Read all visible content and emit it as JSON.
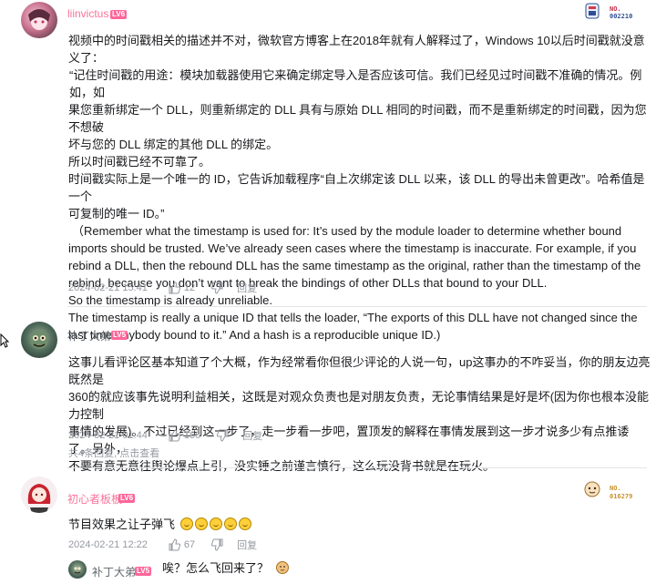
{
  "comment1": {
    "username": "liinvictus",
    "level": "LV6",
    "badge_label": "NO.",
    "badge_number": "002210",
    "lines": [
      "视频中的时间戳相关的描述并不对，微软官方博客上在2018年就有人解释过了，Windows 10以后时间戳就没意义了：",
      "“记住时间戳的用途：模块加载器使用它来确定绑定导入是否应该可信。我们已经见过时间戳不准确的情况。例如，如",
      "果您重新绑定一个 DLL，则重新绑定的 DLL 具有与原始 DLL 相同的时间戳，而不是重新绑定的时间戳，因为您不想破",
      "坏与您的 DLL 绑定的其他 DLL 的绑定。",
      "所以时间戳已经不可靠了。",
      "时间戳实际上是一个唯一的 ID，它告诉加载程序“自上次绑定该 DLL 以来，该 DLL 的导出未曾更改”。哈希值是一个",
      "可复制的唯一 ID。”",
      "（Remember what the timestamp is used for: It’s used by the module loader to determine whether bound",
      "imports should be trusted. We’ve already seen cases where the timestamp is inaccurate. For example, if you",
      "rebind a DLL, then the rebound DLL has the same timestamp as the original, rather than the timestamp of the",
      "rebind, because you don’t want to break the bindings of other DLLs that bound to your DLL.",
      "So the timestamp is already unreliable.",
      "The timestamp is really a unique ID that tells the loader, “The exports of this DLL have not changed since the",
      "last time anybody bound to it.” And a hash is a reproducible unique ID.)"
    ],
    "date": "2024-02-21 15:41",
    "likes": "12",
    "reply_label": "回复"
  },
  "comment2": {
    "username": "补丁大弟",
    "level": "LV5",
    "lines": [
      "这事儿看评论区基本知道了个大概，作为经常看你但很少评论的人说一句，up这事办的不咋妥当，你的朋友边亮既然是",
      "360的就应该事先说明利益相关，这既是对观众负责也是对朋友负责，无论事情结果是好是坏(因为你也根本没能力控制",
      "事情的发展)。不过已经到这一步了，走一步看一步吧，置顶发的解释在事情发展到这一步才说多少有点推诿了。另外，",
      "不要有意无意往舆论爆点上引，没实锤之前谨言慎行，这么玩没背书就是在玩火。"
    ],
    "date": "2024-02-21 01:44",
    "likes": "166",
    "reply_label": "回复",
    "replies_summary": "共4条回复, 点击查看"
  },
  "comment3": {
    "username": "初心者板板",
    "level": "LV6",
    "badge_label": "NO.",
    "badge_number": "016279",
    "text": "节目效果之让子弹飞",
    "emoji_count": 5,
    "date": "2024-02-21 12:22",
    "likes": "67",
    "reply_label": "回复"
  },
  "subreply": {
    "username": "补丁大弟",
    "level": "LV5",
    "text": "唉？怎么飞回来了？"
  }
}
